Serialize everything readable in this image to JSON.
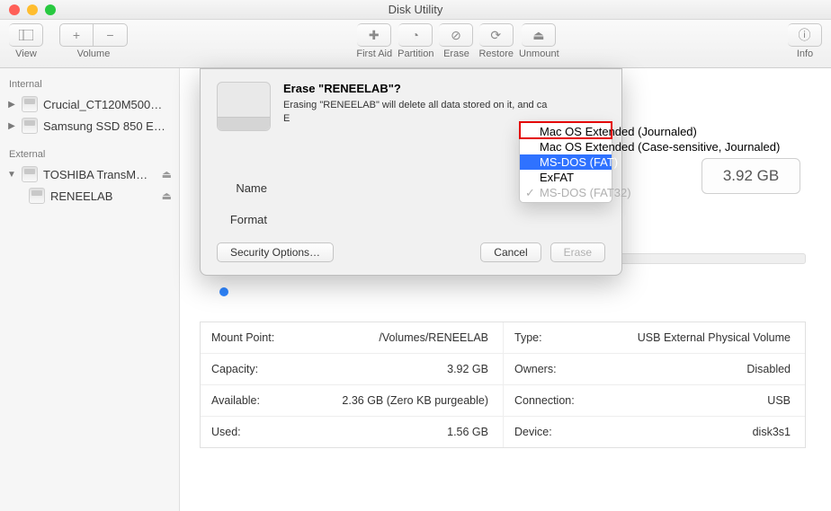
{
  "window": {
    "title": "Disk Utility"
  },
  "toolbar": {
    "view": "View",
    "volume": "Volume",
    "firstaid": "First Aid",
    "partition": "Partition",
    "erase": "Erase",
    "restore": "Restore",
    "unmount": "Unmount",
    "info": "Info"
  },
  "sidebar": {
    "internal": "Internal",
    "external": "External",
    "items": {
      "crucial": "Crucial_CT120M500…",
      "samsung": "Samsung SSD 850 E…",
      "toshiba": "TOSHIBA TransM…",
      "reneelab": "RENEELAB"
    }
  },
  "summary": {
    "capacity": "3.92 GB"
  },
  "sheet": {
    "title": "Erase \"RENEELAB\"?",
    "desc": "Erasing \"RENEELAB\" will delete all data stored on it, and ca",
    "name_label": "Name",
    "format_label": "Format",
    "security": "Security Options…",
    "cancel": "Cancel",
    "erase": "Erase"
  },
  "dropdown": {
    "opt1": "Mac OS Extended (Journaled)",
    "opt2": "Mac OS Extended (Case-sensitive, Journaled)",
    "opt3": "MS-DOS (FAT)",
    "opt4": "ExFAT",
    "opt5": "MS-DOS (FAT32)"
  },
  "info": {
    "mount_k": "Mount Point:",
    "mount_v": "/Volumes/RENEELAB",
    "type_k": "Type:",
    "type_v": "USB External Physical Volume",
    "cap_k": "Capacity:",
    "cap_v": "3.92 GB",
    "own_k": "Owners:",
    "own_v": "Disabled",
    "avail_k": "Available:",
    "avail_v": "2.36 GB (Zero KB purgeable)",
    "conn_k": "Connection:",
    "conn_v": "USB",
    "used_k": "Used:",
    "used_v": "1.56 GB",
    "dev_k": "Device:",
    "dev_v": "disk3s1"
  }
}
